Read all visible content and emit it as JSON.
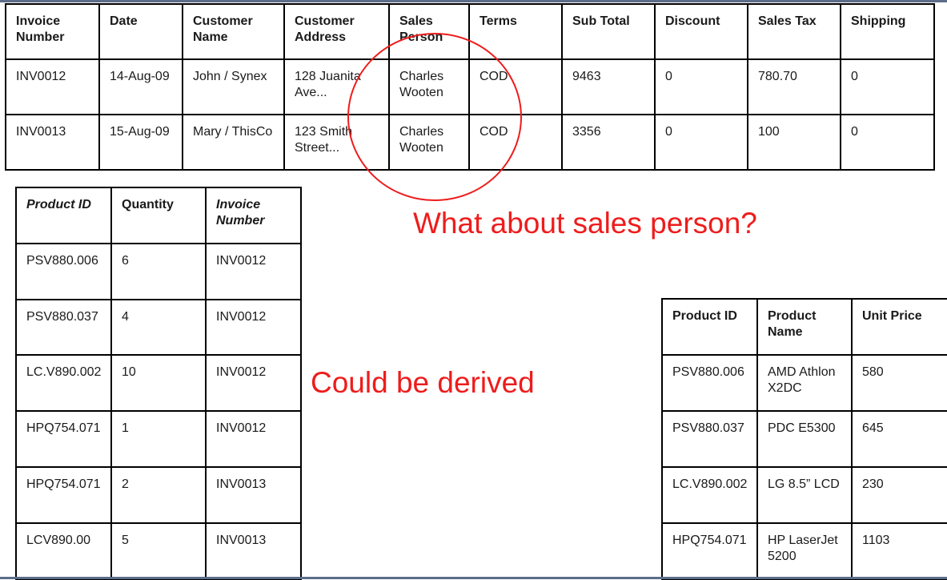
{
  "invoice_table": {
    "headers": [
      "Invoice Number",
      "Date",
      "Customer Name",
      "Customer Address",
      "Sales Person",
      "Terms",
      "Sub Total",
      "Discount",
      "Sales Tax",
      "Shipping"
    ],
    "rows": [
      [
        "INV0012",
        "14-Aug-09",
        "John / Synex",
        "128 Juanita Ave...",
        "Charles Wooten",
        "COD",
        "9463",
        "0",
        "780.70",
        "0"
      ],
      [
        "INV0013",
        "15-Aug-09",
        "Mary / ThisCo",
        "123 Smith Street...",
        "Charles Wooten",
        "COD",
        "3356",
        "0",
        "100",
        "0"
      ]
    ]
  },
  "line_items_table": {
    "headers": [
      "Product ID",
      "Quantity",
      "Invoice Number"
    ],
    "rows": [
      [
        "PSV880.006",
        "6",
        "INV0012"
      ],
      [
        "PSV880.037",
        "4",
        "INV0012"
      ],
      [
        "LC.V890.002",
        "10",
        "INV0012"
      ],
      [
        "HPQ754.071",
        "1",
        "INV0012"
      ],
      [
        "HPQ754.071",
        "2",
        "INV0013"
      ],
      [
        "LCV890.00",
        "5",
        "INV0013"
      ]
    ]
  },
  "product_table": {
    "headers": [
      "Product ID",
      "Product Name",
      "Unit Price"
    ],
    "rows": [
      [
        "PSV880.006",
        "AMD Athlon X2DC",
        "580"
      ],
      [
        "PSV880.037",
        "PDC E5300",
        "645"
      ],
      [
        "LC.V890.002",
        "LG 8.5” LCD",
        "230"
      ],
      [
        "HPQ754.071",
        "HP LaserJet 5200",
        "1103"
      ]
    ]
  },
  "annotations": {
    "sales_person_question": "What about sales person?",
    "derived_note": "Could be derived",
    "highlight_color": "#ee1c1c"
  }
}
